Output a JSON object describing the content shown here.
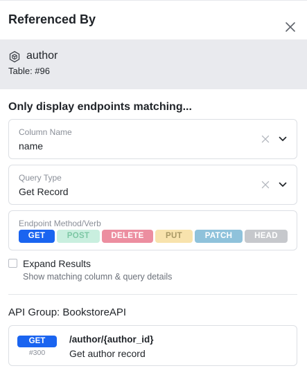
{
  "panel": {
    "title": "Referenced By"
  },
  "reference": {
    "name": "author",
    "table": "Table: #96",
    "icon": "table-hex-icon"
  },
  "filters": {
    "heading": "Only display endpoints matching...",
    "column": {
      "label": "Column Name",
      "value": "name"
    },
    "query_type": {
      "label": "Query Type",
      "value": "Get Record"
    },
    "methods": {
      "label": "Endpoint Method/Verb",
      "items": [
        {
          "label": "GET",
          "bg": "#1a64f0",
          "fg": "#ffffff",
          "selected": true
        },
        {
          "label": "POST",
          "bg": "#c9efdf",
          "fg": "#7cc7a4",
          "selected": false
        },
        {
          "label": "DELETE",
          "bg": "#ec8ea0",
          "fg": "#ffffff",
          "selected": false
        },
        {
          "label": "PUT",
          "bg": "#f8e3ad",
          "fg": "#a89864",
          "selected": false
        },
        {
          "label": "PATCH",
          "bg": "#8fc2db",
          "fg": "#ffffff",
          "selected": false
        },
        {
          "label": "HEAD",
          "bg": "#c6c8cc",
          "fg": "#ffffff",
          "selected": false
        }
      ]
    }
  },
  "expand": {
    "label": "Expand Results",
    "description": "Show matching column & query details",
    "checked": false
  },
  "results": {
    "group_heading": "API Group: BookstoreAPI",
    "endpoints": [
      {
        "method": "GET",
        "id": "#300",
        "path": "/author/{author_id}",
        "description": "Get author record"
      }
    ]
  },
  "colors": {
    "accent": "#1a64f0",
    "reference_bg": "#e9eaee",
    "border": "#dcdfe4"
  }
}
